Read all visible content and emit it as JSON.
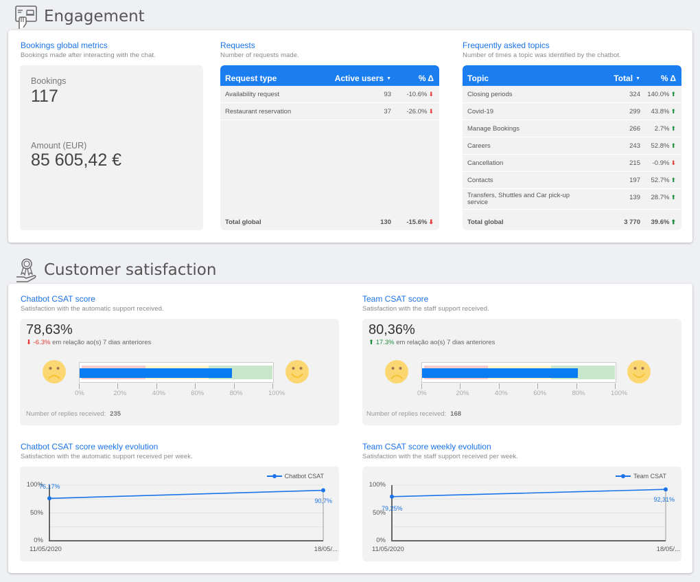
{
  "engagement": {
    "title": "Engagement",
    "icon": "booking-hand-icon",
    "bookings": {
      "title": "Bookings global metrics",
      "subtitle": "Bookings made after interacting with the chat.",
      "bookings_label": "Bookings",
      "bookings_value": "117",
      "amount_label": "Amount (EUR)",
      "amount_value": "85 605,42 €"
    },
    "requests": {
      "title": "Requests",
      "subtitle": "Number of requests made.",
      "columns": [
        "Request type",
        "Active users",
        "% Δ"
      ],
      "sort_indicator": "▼",
      "rows": [
        {
          "label": "Availability request",
          "value": "93",
          "delta": "-10.6%",
          "trend": "down"
        },
        {
          "label": "Restaurant reservation",
          "value": "37",
          "delta": "-26.0%",
          "trend": "down"
        }
      ],
      "total": {
        "label": "Total global",
        "value": "130",
        "delta": "-15.6%",
        "trend": "down"
      }
    },
    "topics": {
      "title": "Frequently asked topics",
      "subtitle": "Number of times a topic was identified by the chatbot.",
      "columns": [
        "Topic",
        "Total",
        "% Δ"
      ],
      "sort_indicator": "▼",
      "rows": [
        {
          "label": "Closing periods",
          "value": "324",
          "delta": "140.0%",
          "trend": "up"
        },
        {
          "label": "Covid-19",
          "value": "299",
          "delta": "43.8%",
          "trend": "up"
        },
        {
          "label": "Manage Bookings",
          "value": "266",
          "delta": "2.7%",
          "trend": "up"
        },
        {
          "label": "Careers",
          "value": "243",
          "delta": "52.8%",
          "trend": "up"
        },
        {
          "label": "Cancellation",
          "value": "215",
          "delta": "-0.9%",
          "trend": "down"
        },
        {
          "label": "Contacts",
          "value": "197",
          "delta": "52.7%",
          "trend": "up"
        },
        {
          "label": "Transfers, Shuttles and Car pick-up service",
          "value": "139",
          "delta": "28.7%",
          "trend": "up"
        }
      ],
      "total": {
        "label": "Total global",
        "value": "3 770",
        "delta": "39.6%",
        "trend": "up"
      }
    }
  },
  "satisfaction": {
    "title": "Customer satisfaction",
    "icon": "award-hand-icon",
    "chatbot_csat": {
      "title": "Chatbot CSAT score",
      "subtitle": "Satisfaction with the automatic support received.",
      "value": "78,63%",
      "value_fraction": 0.7863,
      "delta": "-6.3%",
      "trend": "down",
      "delta_text": "em relação ao(s) 7 dias anteriores",
      "axis_labels": [
        "0%",
        "20%",
        "40%",
        "60%",
        "80%",
        "100%"
      ],
      "replies_label": "Number of replies received:",
      "replies_value": "235"
    },
    "team_csat": {
      "title": "Team CSAT score",
      "subtitle": "Satisfaction with the staff support received.",
      "value": "80,36%",
      "value_fraction": 0.8036,
      "delta": "17.3%",
      "trend": "up",
      "delta_text": "em relação ao(s) 7 dias anteriores",
      "axis_labels": [
        "0%",
        "20%",
        "40%",
        "60%",
        "80%",
        "100%"
      ],
      "replies_label": "Number of replies received:",
      "replies_value": "168"
    },
    "bands": {
      "red_end": 0.333,
      "yellow_end": 0.666,
      "green_end": 1.0,
      "colors": {
        "red": "#f4cccc",
        "yellow": "#fff2cc",
        "green": "#c8e6c9",
        "bar": "#0a7cf2"
      }
    }
  },
  "chart_data": [
    {
      "type": "line",
      "title": "Chatbot CSAT score weekly evolution",
      "subtitle": "Satisfaction with the automatic support received per week.",
      "x": [
        "11/05/2020",
        "18/05/..."
      ],
      "series": [
        {
          "name": "Chatbot CSAT",
          "values": [
            76.17,
            90.7
          ],
          "labels": [
            "76,17%",
            "90,7%"
          ]
        }
      ],
      "ytick_labels": [
        "0%",
        "50%",
        "100%"
      ],
      "ylim": [
        0,
        100
      ],
      "grid": true,
      "legend": "top-right",
      "color": "#1a73e8"
    },
    {
      "type": "line",
      "title": "Team CSAT score weekly evolution",
      "subtitle": "Satisfaction with the staff support received per week.",
      "x": [
        "11/05/2020",
        "18/05/..."
      ],
      "series": [
        {
          "name": "Team CSAT",
          "values": [
            79.25,
            92.31
          ],
          "labels": [
            "79,25%",
            "92,31%"
          ]
        }
      ],
      "ytick_labels": [
        "0%",
        "50%",
        "100%"
      ],
      "ylim": [
        0,
        100
      ],
      "grid": true,
      "legend": "top-right",
      "color": "#1a73e8"
    }
  ]
}
